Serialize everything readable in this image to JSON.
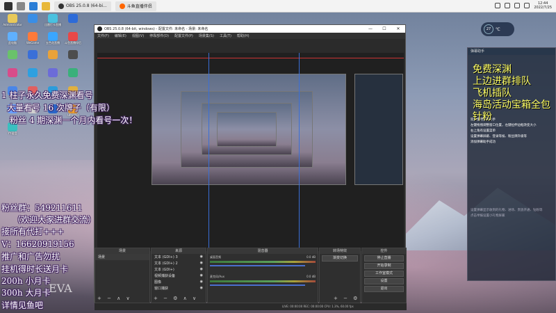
{
  "taskbar": {
    "apps": [
      {
        "label": "OBS 25.0.8 (64-bi..."
      },
      {
        "label": "斗鱼直播伴侣"
      }
    ],
    "clock_time": "12:44",
    "clock_date": "2022/7/25"
  },
  "desktop_icons": [
    {
      "label": "Administrator"
    },
    {
      "label": ""
    },
    {
      "label": "迅雷打卡直播"
    },
    {
      "label": ""
    },
    {
      "label": "此电脑"
    },
    {
      "label": "WeGame"
    },
    {
      "label": "五色花直播"
    },
    {
      "label": "斗鱼直播伴侣"
    },
    {
      "label": ""
    },
    {
      "label": ""
    },
    {
      "label": ""
    },
    {
      "label": ""
    },
    {
      "label": ""
    },
    {
      "label": ""
    },
    {
      "label": ""
    },
    {
      "label": ""
    },
    {
      "label": ""
    },
    {
      "label": ""
    },
    {
      "label": ""
    },
    {
      "label": ""
    },
    {
      "label": ""
    },
    {
      "label": ""
    },
    {
      "label": ""
    },
    {
      "label": "UPUP00"
    },
    {
      "label": "YY语音"
    }
  ],
  "overlay_left": [
    "1 柱子永久免费深渊看号",
    "大量看号 16 次牌子（有限）",
    "粉丝 4 期深渊一个月内看号一次！",
    "粉丝群：549211611",
    "（欢迎大家进群交流）",
    "接所有代打+++",
    "V：16620919156",
    "推广和广告勿扰",
    "挂机得时长送月卡",
    "200h 小月卡",
    "300h 大月卡",
    "详情见鱼吧"
  ],
  "overlay_right": [
    "免费深渊",
    "上边进群排队",
    "飞机插队",
    "海岛活动宝箱全包",
    "针粉"
  ],
  "obs": {
    "title": "OBS 25.0.8 (64-bit, windows) - 配置文件: 未命名 - 场景: 未命名",
    "menu": [
      "文件(F)",
      "编辑(E)",
      "视图(V)",
      "停靠部件(D)",
      "配置文件(P)",
      "场景集(S)",
      "工具(T)",
      "帮助(H)"
    ],
    "window_controls": [
      "—",
      "☐",
      "✕"
    ],
    "docks": {
      "scenes_title": "场景",
      "scene_item": "场景",
      "sources_title": "来源",
      "sources": [
        "文本 (GDI+) 3",
        "文本 (GDI+) 2",
        "文本 (GDI+)",
        "视频捕获设备",
        "图像",
        "窗口捕获"
      ],
      "mixer_title": "混音器",
      "mixer": [
        {
          "name": "桌面音频",
          "db": "0.0 dB"
        },
        {
          "name": "麦克风/Aux",
          "db": "0.0 dB"
        }
      ],
      "transitions_title": "转场特效",
      "transition": "渐变切换",
      "controls_title": "控件",
      "controls": [
        "停止直播",
        "开始录制",
        "工作室模式",
        "设置",
        "退出"
      ]
    },
    "status": "LIVE: 00:00:00  REC: 00:00:00  CPU: 1.3%, 60.00 fps"
  },
  "chat": {
    "title": "弹幕助手",
    "lines": [
      "欢迎使用弹幕助手",
      "左键拖拽调整窗口位置，左键拉伸边框改变大小",
      "右上角有设置菜单",
      "设置弹幕屏蔽、登录等候、粉丝牌升级等",
      "添加弹幕助手成功"
    ],
    "footer_lines": [
      "设置弹幕显示收到的礼物、进场、贵族开通、钻粉等",
      "点击举报设置小礼物屏蔽"
    ]
  },
  "weather": {
    "temp": "27",
    "unit": "℃"
  },
  "logo_text": "EVA"
}
